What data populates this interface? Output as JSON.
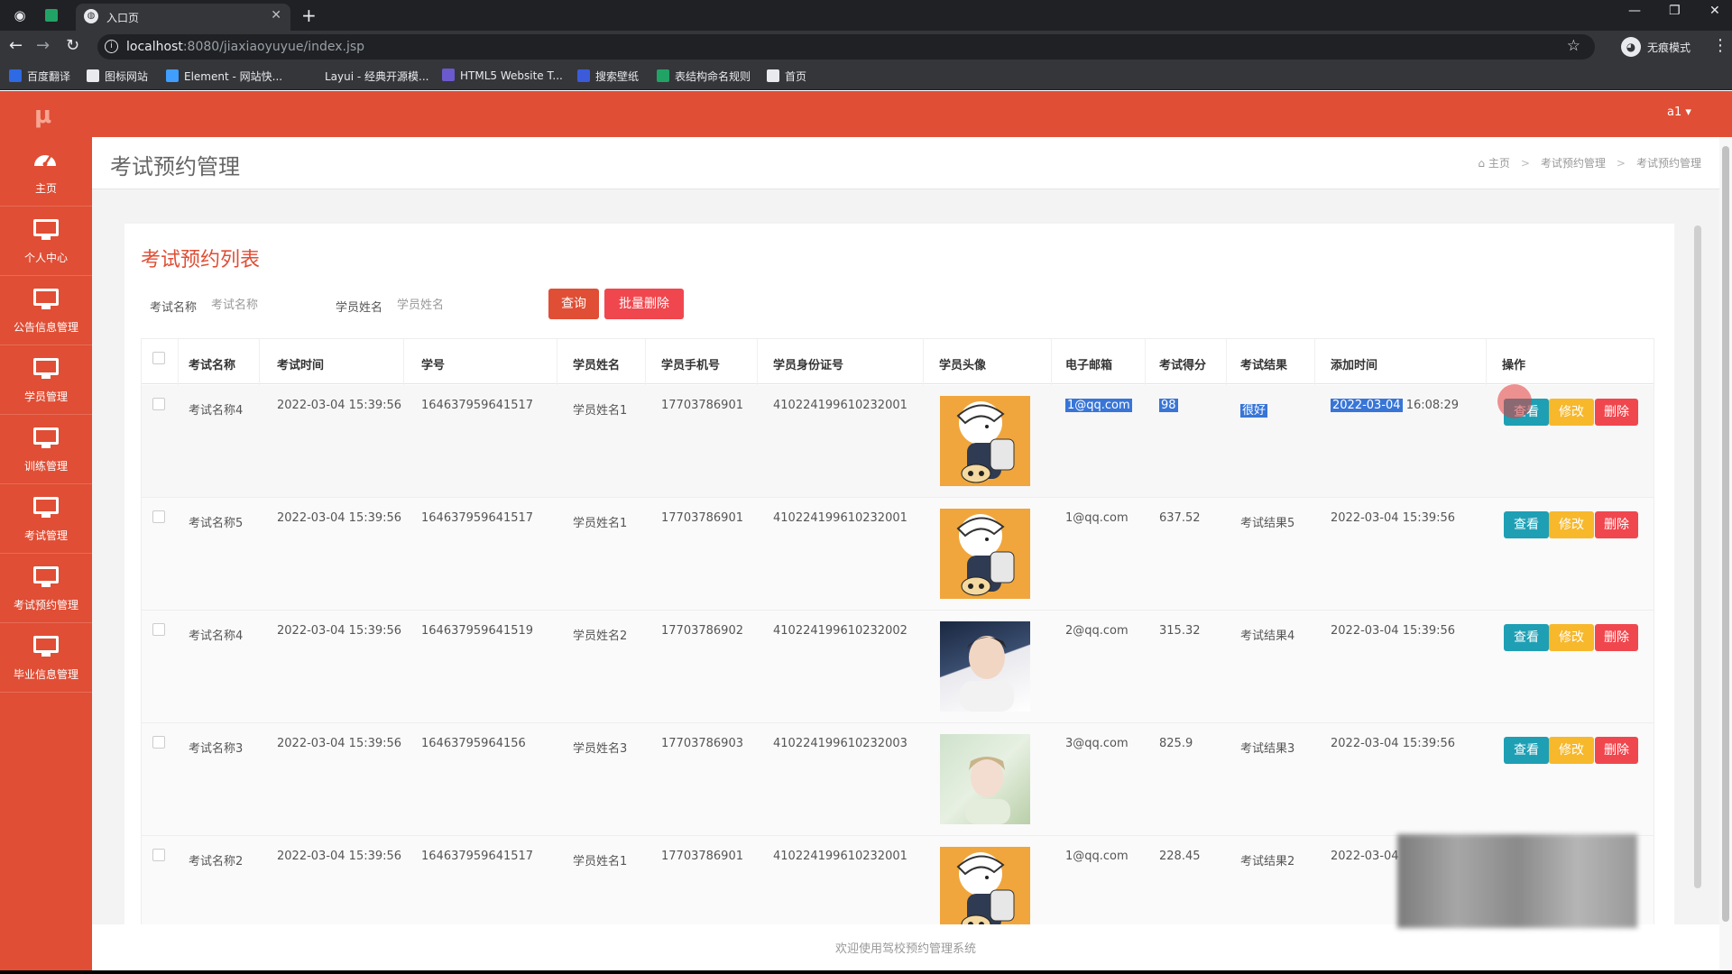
{
  "browser": {
    "tab_title": "入口页",
    "url_host": "localhost",
    "url_path": ":8080/jiaxiaoyuyue/index.jsp",
    "profile_label": "无痕模式",
    "bookmarks": [
      {
        "label": "百度翻译",
        "color": "#2d6ae3"
      },
      {
        "label": "图标网站",
        "color": "#e8eaed"
      },
      {
        "label": "Element - 网站快...",
        "color": "#409eff"
      },
      {
        "label": "Layui - 经典开源模...",
        "color": "#35363a"
      },
      {
        "label": "HTML5 Website T...",
        "color": "#6a5acd"
      },
      {
        "label": "搜索壁纸",
        "color": "#3b5bdb"
      },
      {
        "label": "表结构命名规则",
        "color": "#21a366"
      },
      {
        "label": "首页",
        "color": "#e8eaed"
      }
    ]
  },
  "topbar": {
    "logo": "μ",
    "user": "a1 ▾"
  },
  "sidebar": [
    {
      "label": "主页",
      "icon": "dashboard-icon"
    },
    {
      "label": "个人中心",
      "icon": "monitor-icon"
    },
    {
      "label": "公告信息管理",
      "icon": "monitor-icon"
    },
    {
      "label": "学员管理",
      "icon": "monitor-icon"
    },
    {
      "label": "训练管理",
      "icon": "monitor-icon"
    },
    {
      "label": "考试管理",
      "icon": "monitor-icon"
    },
    {
      "label": "考试预约管理",
      "icon": "monitor-icon"
    },
    {
      "label": "毕业信息管理",
      "icon": "monitor-icon"
    }
  ],
  "header": {
    "title": "考试预约管理",
    "breadcrumb": [
      "主页",
      "考试预约管理",
      "考试预约管理"
    ]
  },
  "panel": {
    "title": "考试预约列表",
    "filters": [
      {
        "label": "考试名称",
        "placeholder": "考试名称"
      },
      {
        "label": "学员姓名",
        "placeholder": "学员姓名"
      }
    ],
    "query_button": "查询",
    "batch_delete_button": "批量删除"
  },
  "table": {
    "columns": [
      "考试名称",
      "考试时间",
      "学号",
      "学员姓名",
      "学员手机号",
      "学员身份证号",
      "学员头像",
      "电子邮箱",
      "考试得分",
      "考试结果",
      "添加时间",
      "操作"
    ],
    "action_labels": {
      "view": "查看",
      "edit": "修改",
      "delete": "删除"
    },
    "rows": [
      {
        "exam_name": "考试名称4",
        "exam_time": "2022-03-04 15:39:56",
        "student_no": "164637959641517",
        "student_name": "学员姓名1",
        "phone": "17703786901",
        "id_card": "410224199610232001",
        "avatar": "cartoon",
        "email": "1@qq.com",
        "score": "98",
        "result": "很好",
        "added_date": "2022-03-04",
        "added_time": " 16:08:29"
      },
      {
        "exam_name": "考试名称5",
        "exam_time": "2022-03-04 15:39:56",
        "student_no": "164637959641517",
        "student_name": "学员姓名1",
        "phone": "17703786901",
        "id_card": "410224199610232001",
        "avatar": "cartoon",
        "email": "1@qq.com",
        "score": "637.52",
        "result": "考试结果5",
        "added_date": "2022-03-04",
        "added_time": " 15:39:56"
      },
      {
        "exam_name": "考试名称4",
        "exam_time": "2022-03-04 15:39:56",
        "student_no": "164637959641519",
        "student_name": "学员姓名2",
        "phone": "17703786902",
        "id_card": "410224199610232002",
        "avatar": "photo1",
        "email": "2@qq.com",
        "score": "315.32",
        "result": "考试结果4",
        "added_date": "2022-03-04",
        "added_time": " 15:39:56"
      },
      {
        "exam_name": "考试名称3",
        "exam_time": "2022-03-04 15:39:56",
        "student_no": "16463795964156",
        "student_name": "学员姓名3",
        "phone": "17703786903",
        "id_card": "410224199610232003",
        "avatar": "photo2",
        "email": "3@qq.com",
        "score": "825.9",
        "result": "考试结果3",
        "added_date": "2022-03-04",
        "added_time": " 15:39:56"
      },
      {
        "exam_name": "考试名称2",
        "exam_time": "2022-03-04 15:39:56",
        "student_no": "164637959641517",
        "student_name": "学员姓名1",
        "phone": "17703786901",
        "id_card": "410224199610232001",
        "avatar": "cartoon",
        "email": "1@qq.com",
        "score": "228.45",
        "result": "考试结果2",
        "added_date": "2022-03-04",
        "added_time": ""
      }
    ]
  },
  "footer": {
    "text": "欢迎使用驾校预约管理系统"
  },
  "colors": {
    "brand": "#e04e35",
    "view": "#1e9fb4",
    "edit": "#f7b82c",
    "delete": "#f0474e",
    "batch": "#f0474e"
  }
}
